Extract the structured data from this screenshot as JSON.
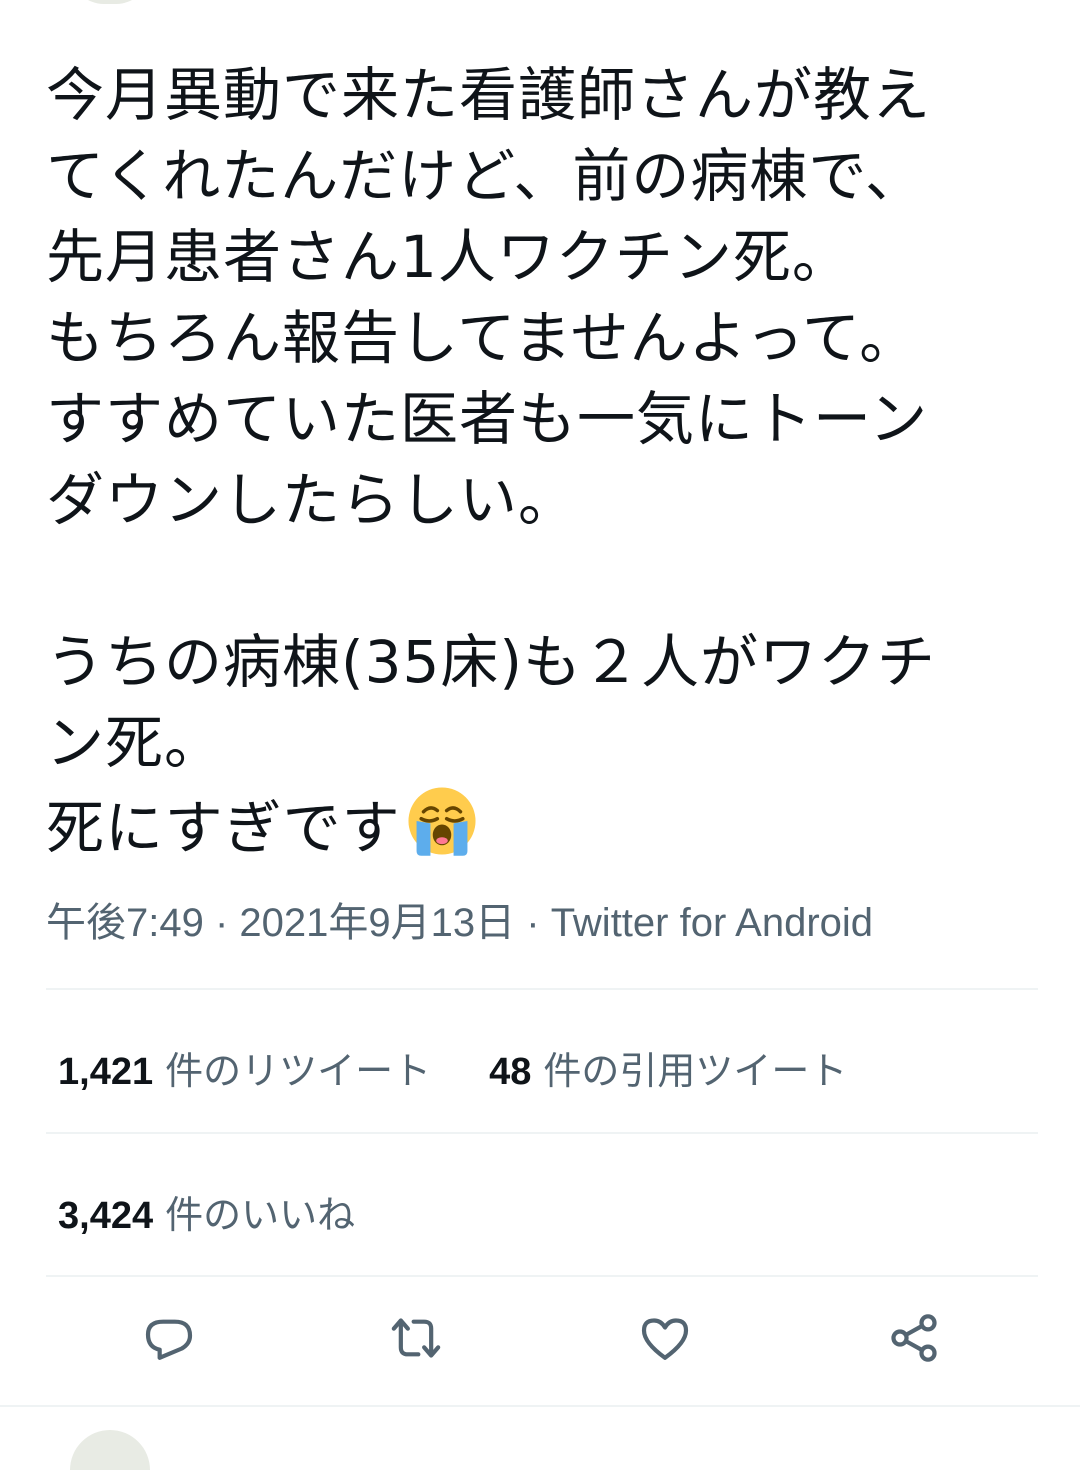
{
  "tweet": {
    "lines": [
      "今月異動で来た看護師さんが教え",
      "てくれたんだけど、前の病棟で、",
      "先月患者さん1人ワクチン死。",
      "もちろん報告してませんよって。",
      "すすめていた医者も一気にトーン",
      "ダウンしたらしい。",
      "",
      "うちの病棟(35床)も２人がワクチ",
      "ン死。",
      "死にすぎです"
    ],
    "emoji": "loudly-crying-face"
  },
  "meta": {
    "time": "午後7:49",
    "sep1": " · ",
    "date": "2021年9月13日",
    "sep2": " · ",
    "source": "Twitter for Android"
  },
  "stats": {
    "retweets": {
      "count": "1,421",
      "label": "件のリツイート"
    },
    "quotes": {
      "count": "48",
      "label": "件の引用ツイート"
    },
    "likes": {
      "count": "3,424",
      "label": "件のいいね"
    }
  },
  "actions": {
    "reply": "reply-icon",
    "retweet": "retweet-icon",
    "like": "heart-icon",
    "share": "share-icon"
  },
  "colors": {
    "text": "#0f1419",
    "secondary": "#536471",
    "divider": "#eff3f4"
  }
}
